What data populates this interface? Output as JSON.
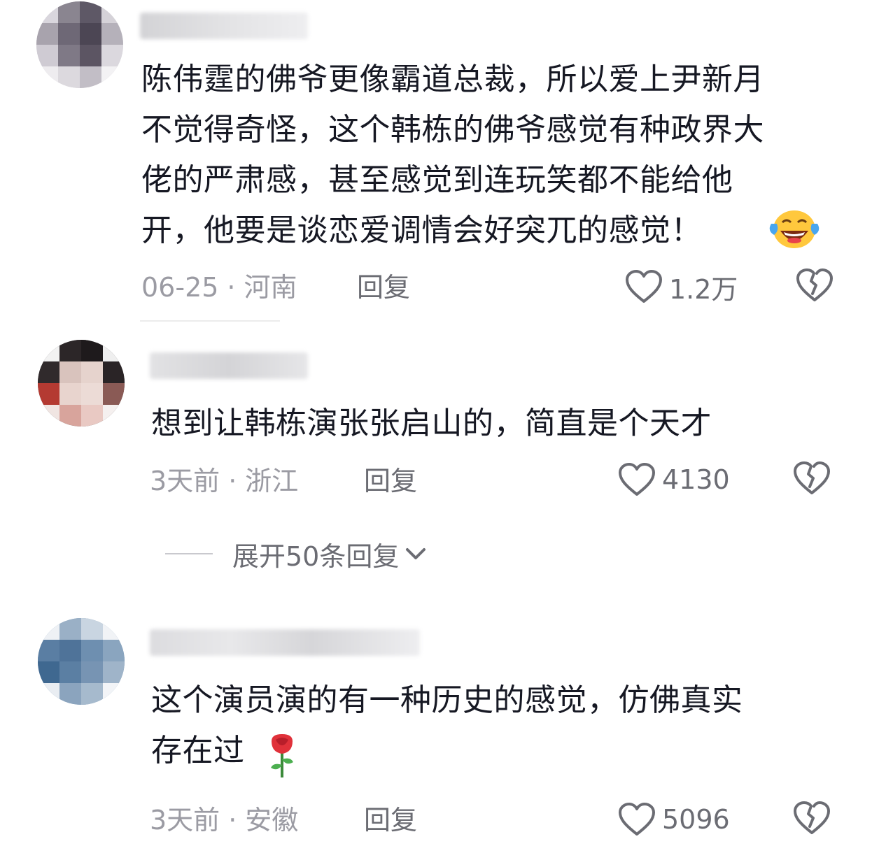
{
  "comments": [
    {
      "text": "陈伟霆的佛爷更像霸道总裁，所以爱上尹新月\n不觉得奇怪，这个韩栋的佛爷感觉有种政界大\n佬的严肃感，甚至感觉到连玩笑都不能给他\n开，他要是谈恋爱调情会好突兀的感觉！",
      "emoji": "laughing-with-tears-emoji",
      "date": "06-25",
      "location": "河南",
      "reply_label": "回复",
      "likes": "1.2万"
    },
    {
      "text": "想到让韩栋演张张启山的，简直是个天才",
      "date": "3天前",
      "location": "浙江",
      "reply_label": "回复",
      "likes": "4130",
      "expand_label": "展开50条回复"
    },
    {
      "text": "这个演员演的有一种历史的感觉，仿佛真实\n存在过",
      "emoji": "rose-emoji",
      "date": "3天前",
      "location": "安徽",
      "reply_label": "回复",
      "likes": "5096"
    }
  ],
  "meta_separator": "·",
  "colors": {
    "text": "#161823",
    "meta": "#9b9ba3",
    "action": "#6b6c73"
  }
}
